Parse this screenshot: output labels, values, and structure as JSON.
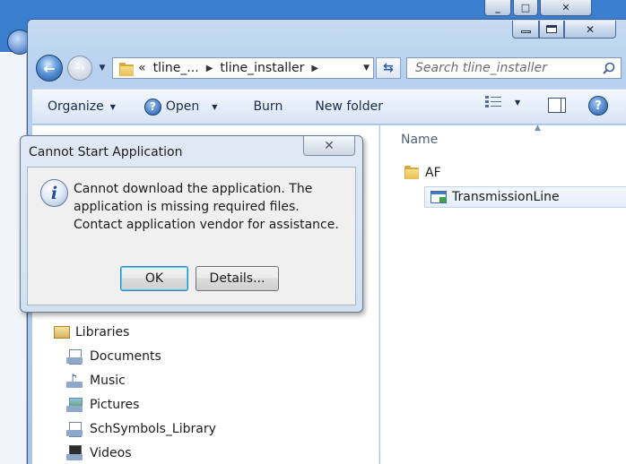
{
  "explorer": {
    "address": {
      "overflow": "«",
      "segments": [
        "tline_...",
        "tline_installer"
      ]
    },
    "search_placeholder": "Search tline_installer",
    "commands": {
      "organize": "Organize",
      "open": "Open",
      "burn": "Burn",
      "new_folder": "New folder"
    },
    "column_name": "Name",
    "files": [
      {
        "name": "AF",
        "icon": "folder-icon"
      },
      {
        "name": "TransmissionLine",
        "icon": "application-icon"
      }
    ],
    "libraries": {
      "header": "Libraries",
      "items": [
        {
          "label": "Documents",
          "icon": "documents-library-icon"
        },
        {
          "label": "Music",
          "icon": "music-library-icon"
        },
        {
          "label": "Pictures",
          "icon": "pictures-library-icon"
        },
        {
          "label": "SchSymbols_Library",
          "icon": "documents-library-icon"
        },
        {
          "label": "Videos",
          "icon": "videos-library-icon"
        }
      ]
    }
  },
  "dialog": {
    "title": "Cannot Start Application",
    "message": "Cannot download the application. The application is missing required files. Contact application vendor for assistance.",
    "ok_label": "OK",
    "details_label": "Details..."
  },
  "colors": {
    "desktop_blue": "#2c6cc0",
    "window_frame": "#b7d0ee",
    "selection": "#e4eef9"
  }
}
